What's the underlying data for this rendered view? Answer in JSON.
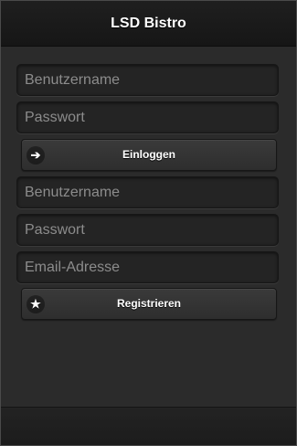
{
  "header": {
    "title": "LSD Bistro"
  },
  "login": {
    "username_placeholder": "Benutzername",
    "password_placeholder": "Passwort",
    "submit_label": "Einloggen",
    "submit_icon": "arrow-right-icon"
  },
  "register": {
    "username_placeholder": "Benutzername",
    "password_placeholder": "Passwort",
    "email_placeholder": "Email-Adresse",
    "submit_label": "Registrieren",
    "submit_icon": "star-icon"
  }
}
